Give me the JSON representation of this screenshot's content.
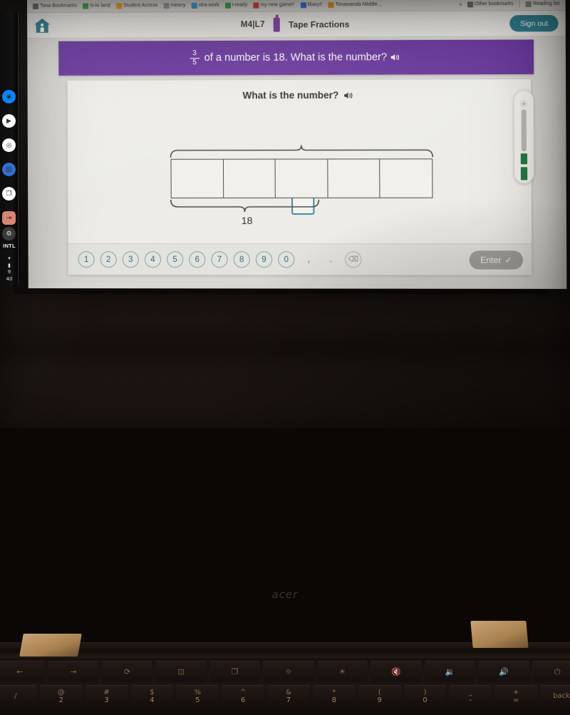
{
  "browser": {
    "bookmarks": [
      {
        "label": "Tona Bookmarks",
        "icon": "folder-icon",
        "color": "#6f6d69"
      },
      {
        "label": "lo-lo land",
        "icon": "globe-icon",
        "color": "#3fa34d"
      },
      {
        "label": "Student Access",
        "icon": "circle-icon",
        "color": "#f0a020"
      },
      {
        "label": "meany",
        "icon": "image-icon",
        "color": "#9b9b9b"
      },
      {
        "label": "xtra-work",
        "icon": "person-icon",
        "color": "#3d9bd6"
      },
      {
        "label": "i-ready",
        "icon": "iready-icon",
        "color": "#3fa34d"
      },
      {
        "label": "my new game!!",
        "icon": "pinterest-icon",
        "color": "#d5412f"
      },
      {
        "label": "libary!!",
        "icon": "calendar-icon",
        "color": "#2f6fd0"
      },
      {
        "label": "Tonawanda Middle...",
        "icon": "location-icon",
        "color": "#e0912a"
      }
    ],
    "overflow_chevron": "»",
    "other_bookmarks": {
      "label": "Other bookmarks",
      "icon": "folder-icon"
    },
    "reading_list": {
      "label": "Reading list",
      "icon": "reading-list-icon"
    }
  },
  "app_header": {
    "home_icon": "home-icon",
    "lesson_code": "M4|L7",
    "info_icon": "info-icon",
    "lesson_title": "Tape Fractions",
    "sign_out_label": "Sign out",
    "accent_teal": "#2d7b8c",
    "info_purple": "#7b3fa0"
  },
  "prompt": {
    "fraction_numerator": "3",
    "fraction_denominator": "5",
    "text": "of a number is 18. What is the number?",
    "speaker_icon": "speaker-icon",
    "bar_color": "#68359c"
  },
  "main": {
    "question": "What is the number?",
    "question_speaker_icon": "speaker-icon",
    "answer_value": "",
    "answer_placeholder": "",
    "tape": {
      "total_cells": 5,
      "top_brace_cells": 5,
      "top_brace_label": "",
      "bottom_brace_cells": 3,
      "bottom_brace_label": "18"
    }
  },
  "keypad": {
    "keys": [
      "1",
      "2",
      "3",
      "4",
      "5",
      "6",
      "7",
      "8",
      "9",
      "0",
      ",",
      "."
    ],
    "backspace_icon": "backspace-icon",
    "enter_label": "Enter",
    "enter_check_icon": "check-icon",
    "enter_enabled": false,
    "key_color": "#2f6d7e"
  },
  "brightness_slider": {
    "icon": "sun-icon",
    "indicator_color": "#1f7a3d"
  },
  "phone_strip": {
    "app_icons": [
      "messenger-icon",
      "play-store-icon",
      "instagram-icon",
      "docs-icon",
      "photos-icon",
      "exit-icon"
    ],
    "settings_icon": "settings-icon",
    "carrier_label": "INTL",
    "wifi_icon": "wifi-icon",
    "battery_icon": "battery-icon",
    "clock_hour": "9",
    "clock_minute": "40"
  },
  "laptop": {
    "brand": "acer",
    "function_keys": [
      "←",
      "→",
      "⟳",
      "⊡",
      "❐",
      "☼",
      "☀",
      "🔇",
      "🔉",
      "🔊",
      "⏻"
    ],
    "number_row": [
      {
        "sym": "/",
        "dig": ""
      },
      {
        "sym": "@",
        "dig": "2"
      },
      {
        "sym": "#",
        "dig": "3"
      },
      {
        "sym": "$",
        "dig": "4"
      },
      {
        "sym": "%",
        "dig": "5"
      },
      {
        "sym": "^",
        "dig": "6"
      },
      {
        "sym": "&",
        "dig": "7"
      },
      {
        "sym": "*",
        "dig": "8"
      },
      {
        "sym": "(",
        "dig": "9"
      },
      {
        "sym": ")",
        "dig": "0"
      },
      {
        "sym": "_",
        "dig": "-"
      },
      {
        "sym": "+",
        "dig": "="
      },
      {
        "sym": "back",
        "dig": ""
      }
    ]
  }
}
